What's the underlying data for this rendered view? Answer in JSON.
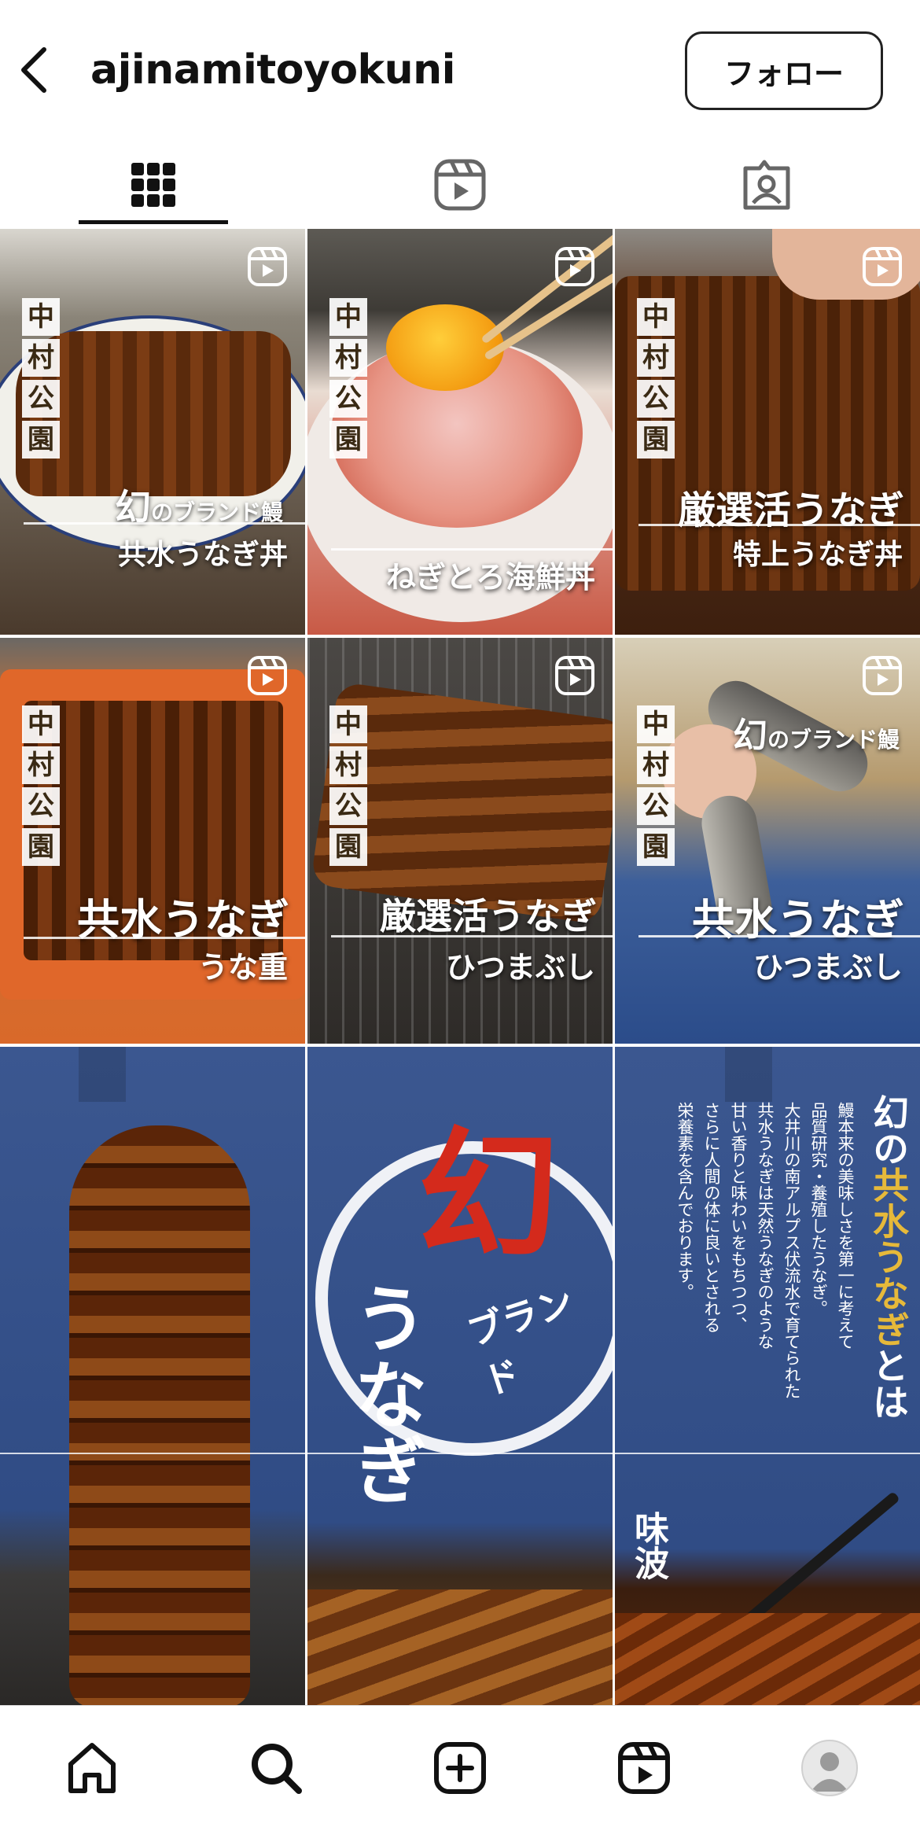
{
  "header": {
    "username": "ajinamitoyokuni",
    "follow_label": "フォロー"
  },
  "tabs": [
    "grid-icon",
    "reels-icon",
    "tagged-icon"
  ],
  "posts": [
    {
      "type": "reel",
      "tag": [
        "中",
        "村",
        "公",
        "園"
      ],
      "line1_a": "幻",
      "line1_b": "のブランド鰻",
      "line2": "共水うなぎ丼"
    },
    {
      "type": "reel",
      "tag": [
        "中",
        "村",
        "公",
        "園"
      ],
      "line2": "ねぎとろ海鮮丼"
    },
    {
      "type": "reel",
      "tag": [
        "中",
        "村",
        "公",
        "園"
      ],
      "line1": "厳選活うなぎ",
      "line2": "特上うなぎ丼"
    },
    {
      "type": "reel",
      "tag": [
        "中",
        "村",
        "公",
        "園"
      ],
      "line1": "共水うなぎ",
      "line2": "うな重"
    },
    {
      "type": "reel",
      "tag": [
        "中",
        "村",
        "公",
        "園"
      ],
      "line1": "厳選活うなぎ",
      "line2": "ひつまぶし"
    },
    {
      "type": "reel",
      "tag": [
        "中",
        "村",
        "公",
        "園"
      ],
      "top_a": "幻",
      "top_b": "のブランド鰻",
      "line1": "共水うなぎ",
      "line2": "ひつまぶし"
    },
    {
      "type": "image"
    },
    {
      "type": "image",
      "big": "幻",
      "brand": "ブランド",
      "side": "うなぎ"
    },
    {
      "type": "image",
      "col_title_1": "幻の",
      "col_title_2": "共水うなぎ",
      "col_title_3": "とは",
      "columns": [
        "鰻本来の美味しさを第一に考えて",
        "品質研究・養殖したうなぎ。",
        "大井川の南アルプス伏流水で育てられた",
        "共水うなぎは天然うなぎのような",
        "甘い香りと味わいをもちつつ、",
        "さらに人間の体に良いとされる",
        "栄養素を含んでおります。"
      ],
      "signature": "味波"
    }
  ],
  "colors": {
    "indigo": "#344f86",
    "eel": "#6b3410",
    "accent_red": "#d42a1c",
    "accent_gold": "#e6b93a"
  },
  "bottom_nav": [
    "home-icon",
    "search-icon",
    "create-icon",
    "reels-icon",
    "profile-avatar"
  ]
}
